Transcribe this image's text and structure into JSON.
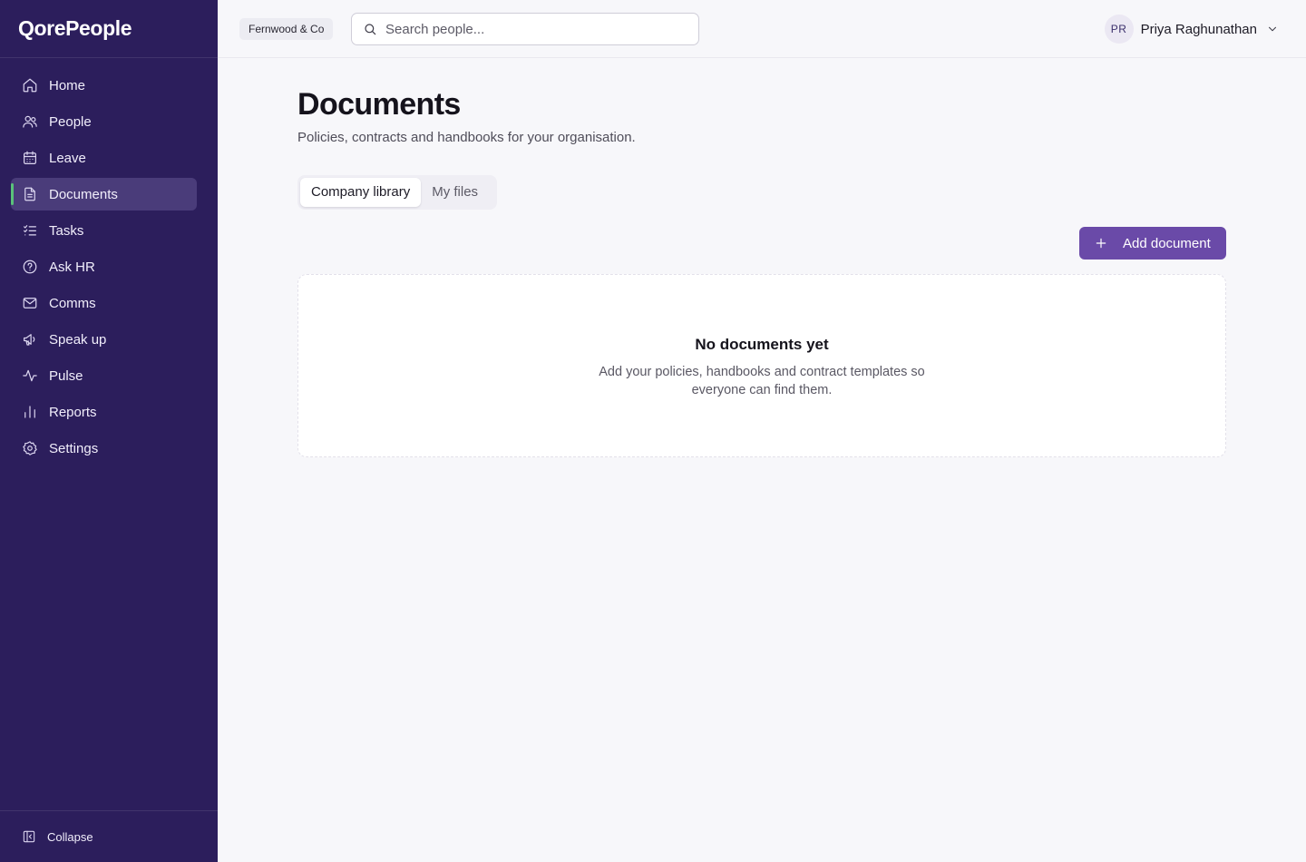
{
  "app": {
    "logo_text": "QorePeople"
  },
  "sidebar": {
    "items": [
      {
        "label": "Home",
        "icon": "home-icon"
      },
      {
        "label": "People",
        "icon": "people-icon"
      },
      {
        "label": "Leave",
        "icon": "calendar-icon"
      },
      {
        "label": "Documents",
        "icon": "document-icon",
        "active": true
      },
      {
        "label": "Tasks",
        "icon": "tasks-icon"
      },
      {
        "label": "Ask HR",
        "icon": "help-circle-icon"
      },
      {
        "label": "Comms",
        "icon": "mail-icon"
      },
      {
        "label": "Speak up",
        "icon": "megaphone-icon"
      },
      {
        "label": "Pulse",
        "icon": "activity-icon"
      },
      {
        "label": "Reports",
        "icon": "bar-chart-icon"
      },
      {
        "label": "Settings",
        "icon": "gear-icon"
      }
    ],
    "collapse_label": "Collapse"
  },
  "topbar": {
    "org_name": "Fernwood & Co",
    "search_placeholder": "Search people...",
    "user_initials": "PR",
    "user_name": "Priya Raghunathan"
  },
  "main": {
    "title": "Documents",
    "subtitle": "Policies, contracts and handbooks for your organisation.",
    "tabs": [
      {
        "label": "Company library",
        "active": true
      },
      {
        "label": "My files",
        "active": false
      }
    ],
    "add_button_label": "Add document",
    "empty_state": {
      "title": "No documents yet",
      "description": "Add your policies, handbooks and contract templates so everyone can find them."
    }
  },
  "colors": {
    "sidebar_bg": "#2c1e5c",
    "active_item_bg": "#4a3c7a",
    "active_indicator": "#5ac27a",
    "primary_button": "#6a4aa8"
  }
}
